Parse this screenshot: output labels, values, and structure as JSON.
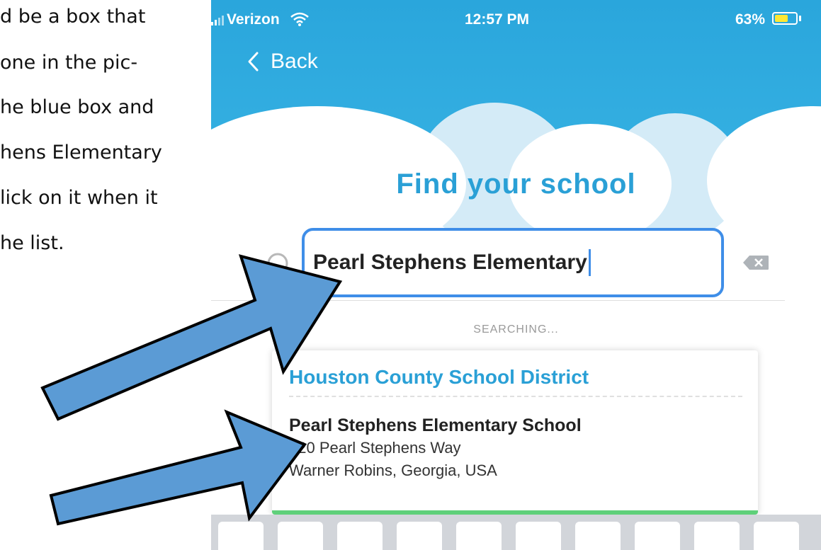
{
  "instructions": {
    "lines": [
      "d be a box that",
      "one in the pic-",
      "he blue box and",
      "hens Elementary",
      "lick on it when it",
      "he list."
    ]
  },
  "status_bar": {
    "carrier": "Verizon",
    "time": "12:57 PM",
    "battery_pct": "63%",
    "battery_level": 0.63,
    "icons": [
      "signal-bars-icon",
      "wifi-icon",
      "battery-icon"
    ]
  },
  "nav": {
    "back_label": "Back",
    "back_icon": "chevron-left-icon"
  },
  "page": {
    "title": "Find your school"
  },
  "search": {
    "value": "Pearl Stephens Elementary",
    "search_icon": "search-icon",
    "clear_icon": "clear-key-icon",
    "status": "SEARCHING..."
  },
  "results": {
    "district": "Houston County School District",
    "school_name": "Pearl Stephens Elementary School",
    "address_line1": "420 Pearl Stephens Way",
    "address_line2": "Warner Robins, Georgia, USA"
  },
  "colors": {
    "header_blue": "#2aa6dc",
    "title_blue": "#2aa0d6",
    "search_border": "#3f8ee8",
    "arrow_fill": "#5b9bd5",
    "battery_yellow": "#ffe833"
  },
  "annotations": {
    "arrow_icon": "arrow-icon",
    "arrow_count": 2
  }
}
